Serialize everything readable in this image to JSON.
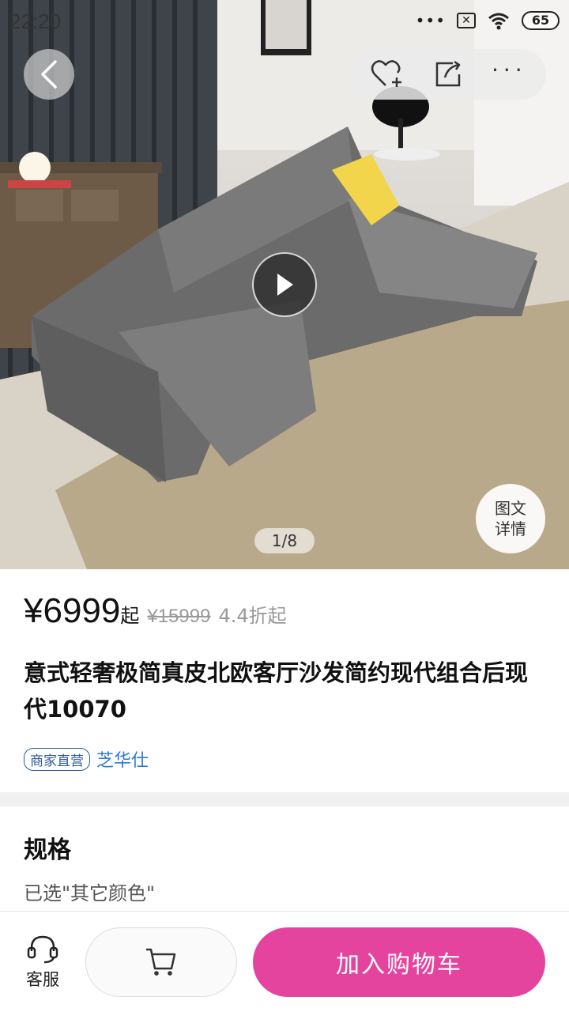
{
  "status_bar": {
    "time": "22:20",
    "battery": "65",
    "icons": [
      "more-dots-icon",
      "no-sim-icon",
      "wifi-icon",
      "battery-icon"
    ]
  },
  "top_nav": {
    "icons": [
      "back-arrow-icon",
      "heart-add-icon",
      "share-icon",
      "more-icon"
    ]
  },
  "gallery": {
    "page_indicator": "1/8",
    "detail_line1": "图文",
    "detail_line2": "详情"
  },
  "product": {
    "price": "¥6999",
    "price_suffix": "起",
    "original_price": "¥15999",
    "discount": "4.4折起",
    "title": "意式轻奢极简真皮北欧客厅沙发简约现代组合后现代10070",
    "shop_badge": "商家直营",
    "shop_name": "芝华仕"
  },
  "spec": {
    "title": "规格",
    "selected": "已选\"其它颜色\""
  },
  "bottom_bar": {
    "service_label": "客服",
    "add_to_cart": "加入购物车"
  },
  "colors": {
    "accent": "#e5449e",
    "shop_link": "#2e7bd0",
    "sofa": "#6b6b6b",
    "pillow": "#f2d54a"
  }
}
